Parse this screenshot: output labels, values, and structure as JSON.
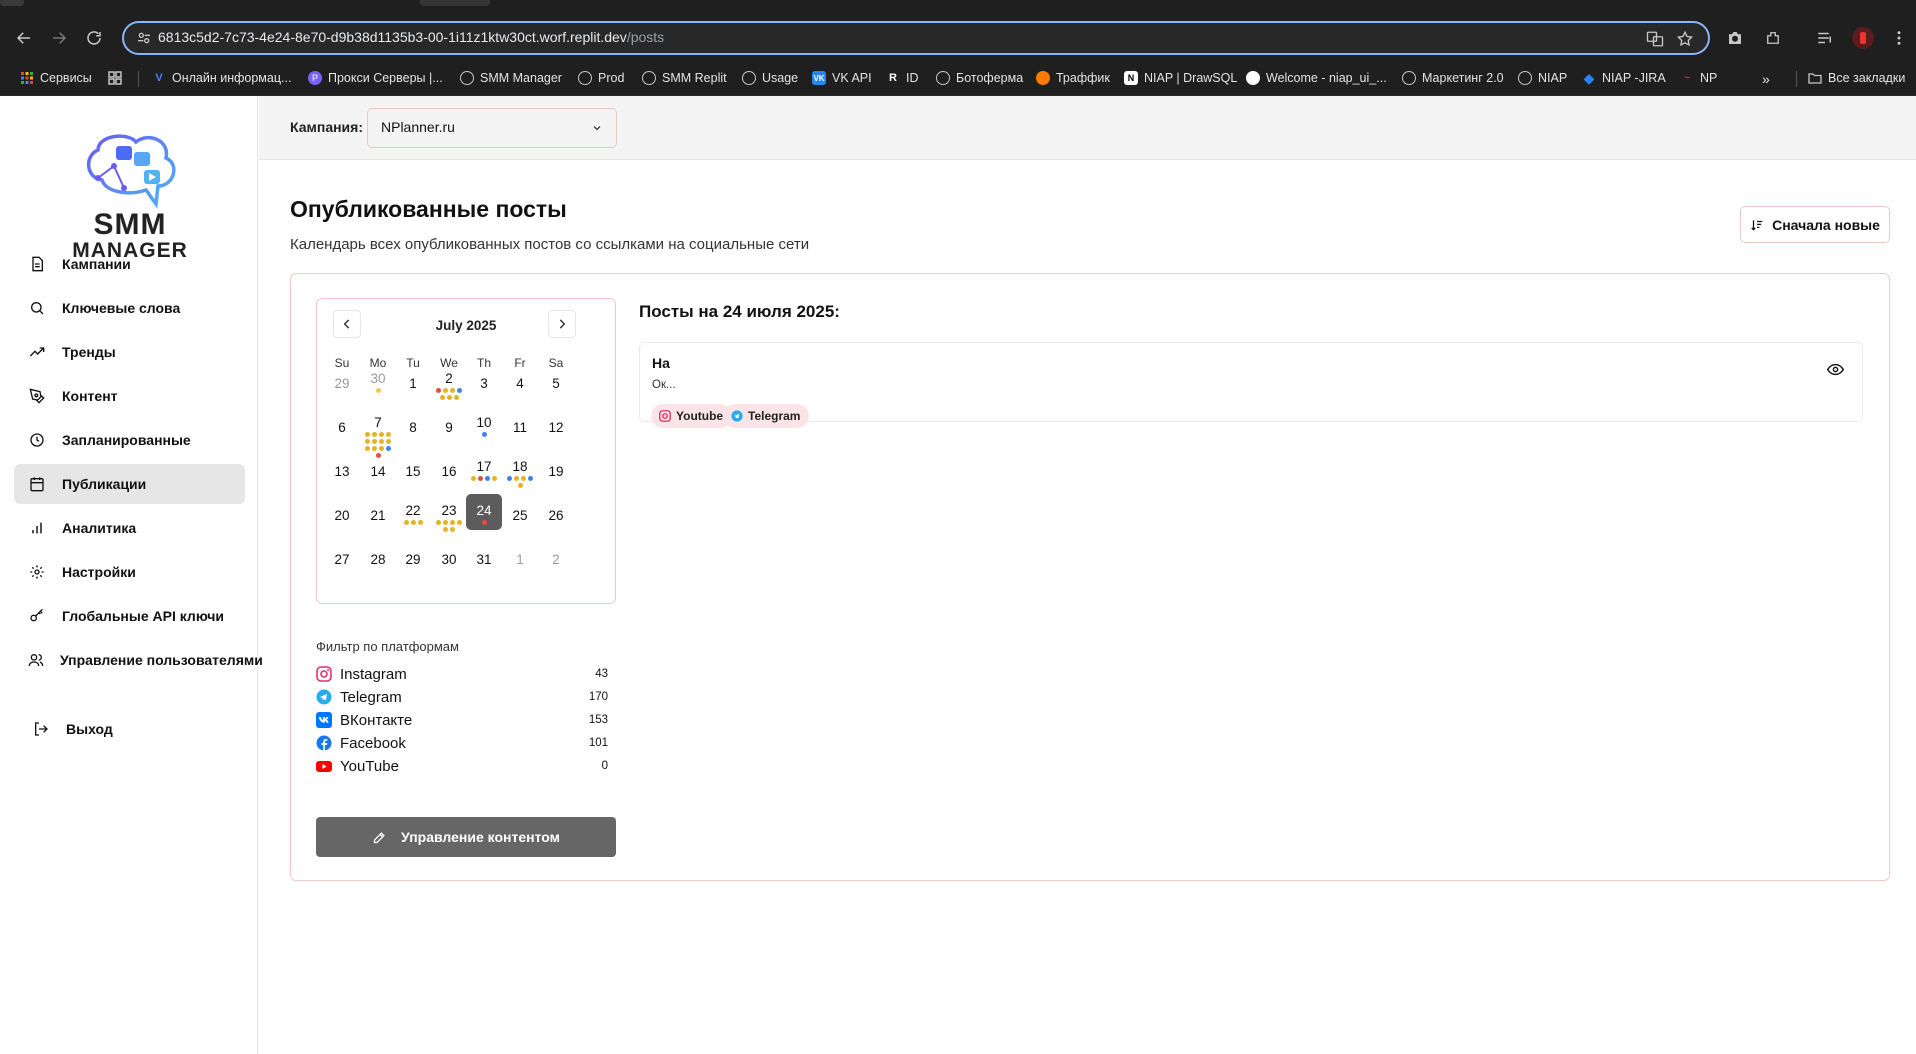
{
  "browser": {
    "url_host": "6813c5d2-7c73-4e24-8e70-d9b38d1135b3-00-1i11z1ktw30ct.worf.replit.dev",
    "url_path": "/posts",
    "bookmarks": [
      {
        "label": "Сервисы",
        "icon": "apps-grid-icon",
        "color": "#ea4335"
      },
      {
        "label": "",
        "icon": "grid-icon",
        "color": "#c7c7c7"
      },
      {
        "label": "Онлайн информац...",
        "icon": "v-logo-icon",
        "color": "#4a7cf7"
      },
      {
        "label": "Прокси Серверы |...",
        "icon": "proxy-logo-icon",
        "color": "#7b61ff"
      },
      {
        "label": "SMM Manager",
        "icon": "globe-icon",
        "color": "#c7c7c7"
      },
      {
        "label": "Prod",
        "icon": "globe-icon",
        "color": "#c7c7c7"
      },
      {
        "label": "SMM Replit",
        "icon": "globe-icon",
        "color": "#c7c7c7"
      },
      {
        "label": "Usage",
        "icon": "globe-icon",
        "color": "#c7c7c7"
      },
      {
        "label": "VK API",
        "icon": "vk-icon",
        "color": "#2787f5"
      },
      {
        "label": "ID",
        "icon": "r-letter-icon",
        "color": "#ffffff"
      },
      {
        "label": "Ботоферма",
        "icon": "globe-icon",
        "color": "#c7c7c7"
      },
      {
        "label": "Траффик",
        "icon": "traffic-logo-icon",
        "color": "#ff7a00"
      },
      {
        "label": "NIAP | DrawSQL",
        "icon": "drawsql-icon",
        "color": "#ffffff"
      },
      {
        "label": "Welcome - niap_ui_...",
        "icon": "github-icon",
        "color": "#ffffff"
      },
      {
        "label": "Маркетинг 2.0",
        "icon": "globe-icon",
        "color": "#c7c7c7"
      },
      {
        "label": "NIAP",
        "icon": "globe-icon",
        "color": "#c7c7c7"
      },
      {
        "label": "NIAP -JIRA",
        "icon": "jira-icon",
        "color": "#2684ff"
      },
      {
        "label": "NP",
        "icon": "np-logo-icon",
        "color": "#e8465b"
      }
    ],
    "all_bookmarks": "Все закладки"
  },
  "sidebar": {
    "logo_line1": "SMM",
    "logo_line2": "MANAGER",
    "items": [
      {
        "label": "Кампании",
        "icon": "document-icon"
      },
      {
        "label": "Ключевые слова",
        "icon": "search-icon"
      },
      {
        "label": "Тренды",
        "icon": "trending-up-icon"
      },
      {
        "label": "Контент",
        "icon": "pen-tool-icon"
      },
      {
        "label": "Запланированные",
        "icon": "clock-icon"
      },
      {
        "label": "Публикации",
        "icon": "calendar-icon",
        "active": true
      },
      {
        "label": "Аналитика",
        "icon": "bar-chart-icon"
      },
      {
        "label": "Настройки",
        "icon": "gear-icon"
      },
      {
        "label": "Глобальные API ключи",
        "icon": "key-icon"
      },
      {
        "label": "Управление пользователями",
        "icon": "users-icon"
      }
    ],
    "logout": "Выход"
  },
  "topbar": {
    "campaign_label": "Кампания:",
    "campaign_value": "NPlanner.ru"
  },
  "page": {
    "title": "Опубликованные посты",
    "subtitle": "Календарь всех опубликованных постов со ссылками на социальные сети",
    "sort_button": "Сначала новые"
  },
  "calendar": {
    "month_label": "July 2025",
    "weekdays": [
      "Su",
      "Mo",
      "Tu",
      "We",
      "Th",
      "Fr",
      "Sa"
    ],
    "selected_day": 24,
    "weeks": [
      [
        {
          "d": "29",
          "out": true
        },
        {
          "d": "30",
          "out": true,
          "dots": [
            "#f2c94c"
          ]
        },
        {
          "d": "1"
        },
        {
          "d": "2",
          "dots": [
            "#e74c3c",
            "#e6b325",
            "#e6b325",
            "#3b82f6",
            "#e6b325",
            "#e6b325",
            "#e6b325"
          ]
        },
        {
          "d": "3"
        },
        {
          "d": "4"
        },
        {
          "d": "5"
        }
      ],
      [
        {
          "d": "6"
        },
        {
          "d": "7",
          "dots": [
            "#e6b325",
            "#e6b325",
            "#e6b325",
            "#e6b325",
            "#e6b325",
            "#e6b325",
            "#e6b325",
            "#e6b325",
            "#e6b325",
            "#e6b325",
            "#e6b325",
            "#3b82f6",
            "#e74c3c"
          ]
        },
        {
          "d": "8"
        },
        {
          "d": "9"
        },
        {
          "d": "10",
          "dots": [
            "#3b82f6"
          ]
        },
        {
          "d": "11"
        },
        {
          "d": "12"
        }
      ],
      [
        {
          "d": "13"
        },
        {
          "d": "14"
        },
        {
          "d": "15"
        },
        {
          "d": "16"
        },
        {
          "d": "17",
          "dots": [
            "#e6b325",
            "#e74c3c",
            "#3b82f6",
            "#e6b325"
          ]
        },
        {
          "d": "18",
          "dots": [
            "#3b82f6",
            "#e6b325",
            "#e6b325",
            "#3b82f6",
            "#e6b325"
          ]
        },
        {
          "d": "19"
        }
      ],
      [
        {
          "d": "20"
        },
        {
          "d": "21"
        },
        {
          "d": "22",
          "dots": [
            "#e6b325",
            "#e6b325",
            "#e6b325"
          ]
        },
        {
          "d": "23",
          "dots": [
            "#e6b325",
            "#e6b325",
            "#e6b325",
            "#e6b325",
            "#e6b325",
            "#e6b325"
          ]
        },
        {
          "d": "24",
          "dots": [
            "#e74c3c"
          ]
        },
        {
          "d": "25"
        },
        {
          "d": "26"
        }
      ],
      [
        {
          "d": "27"
        },
        {
          "d": "28"
        },
        {
          "d": "29"
        },
        {
          "d": "30"
        },
        {
          "d": "31"
        },
        {
          "d": "1",
          "out": true
        },
        {
          "d": "2",
          "out": true
        }
      ]
    ]
  },
  "filter": {
    "title": "Фильтр по платформам",
    "platforms": [
      {
        "name": "Instagram",
        "count": "43",
        "icon": "instagram-icon",
        "color": "#e1306c"
      },
      {
        "name": "Telegram",
        "count": "170",
        "icon": "telegram-icon",
        "color": "#2aabee"
      },
      {
        "name": "ВКонтакте",
        "count": "153",
        "icon": "vk-icon",
        "color": "#0077ff"
      },
      {
        "name": "Facebook",
        "count": "101",
        "icon": "facebook-icon",
        "color": "#1877f2"
      },
      {
        "name": "YouTube",
        "count": "0",
        "icon": "youtube-icon",
        "color": "#ff0000"
      }
    ]
  },
  "manage_button": "Управление контентом",
  "posts": {
    "date_heading": "Посты на 24 июля 2025:",
    "items": [
      {
        "title": "На",
        "text": "Ок...",
        "tags": [
          {
            "label": "Youtube",
            "icon": "instagram-icon",
            "color": "#e1306c"
          },
          {
            "label": "Telegram",
            "icon": "telegram-icon",
            "color": "#2aabee"
          }
        ]
      }
    ]
  }
}
